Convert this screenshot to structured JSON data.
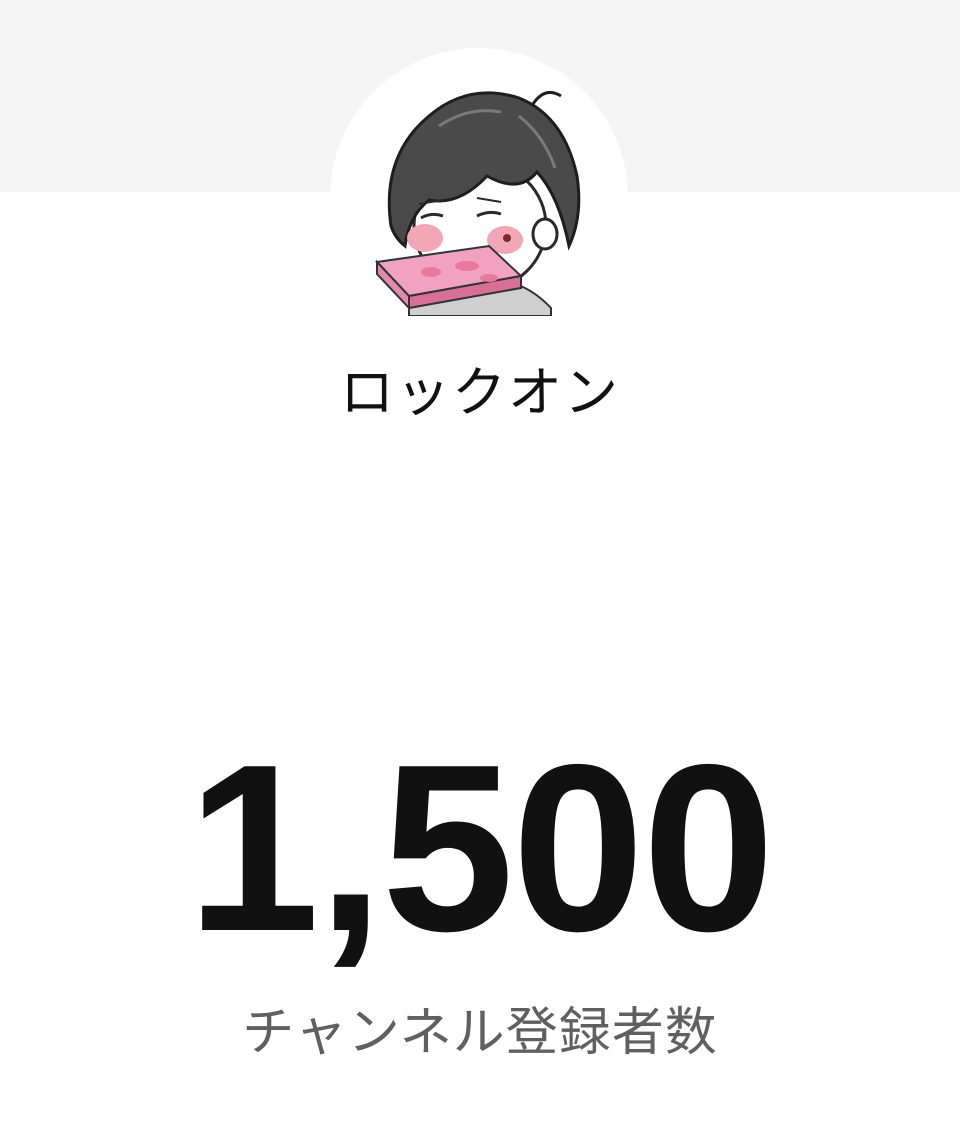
{
  "channel": {
    "name": "ロックオン",
    "avatar_icon": "cartoon-avatar-icon"
  },
  "stats": {
    "subscriber_count": "1,500",
    "subscriber_label": "チャンネル登録者数"
  },
  "colors": {
    "band": "#f5f5f5",
    "text_primary": "#111111",
    "text_secondary": "#606060",
    "accent_pink": "#e8799a"
  }
}
